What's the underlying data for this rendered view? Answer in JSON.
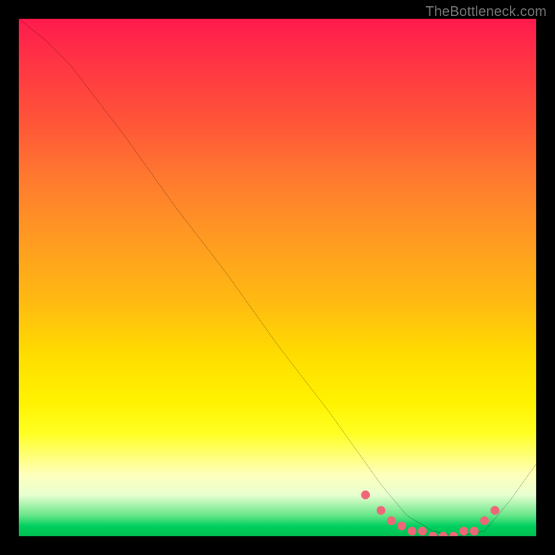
{
  "attribution": "TheBottleneck.com",
  "chart_data": {
    "type": "line",
    "title": "",
    "xlabel": "",
    "ylabel": "",
    "xlim": [
      0,
      100
    ],
    "ylim": [
      0,
      100
    ],
    "series": [
      {
        "name": "curve",
        "x": [
          0,
          5,
          10,
          20,
          30,
          40,
          50,
          60,
          65,
          70,
          75,
          80,
          85,
          90,
          95,
          100
        ],
        "values": [
          100,
          96,
          91,
          78,
          64,
          51,
          37,
          24,
          17,
          10,
          4,
          1,
          0,
          1,
          7,
          14
        ]
      }
    ],
    "markers": {
      "name": "valley-markers",
      "color": "#ee6677",
      "x": [
        67,
        70,
        72,
        74,
        76,
        78,
        80,
        82,
        84,
        86,
        88,
        90,
        92
      ],
      "values": [
        8,
        5,
        3,
        2,
        1,
        1,
        0,
        0,
        0,
        1,
        1,
        3,
        5
      ]
    },
    "colors": {
      "gradient_top": "#ff1a4d",
      "gradient_mid": "#ffee00",
      "gradient_bottom": "#00c050",
      "curve": "#000000",
      "marker": "#ee6677",
      "frame": "#000000"
    }
  }
}
